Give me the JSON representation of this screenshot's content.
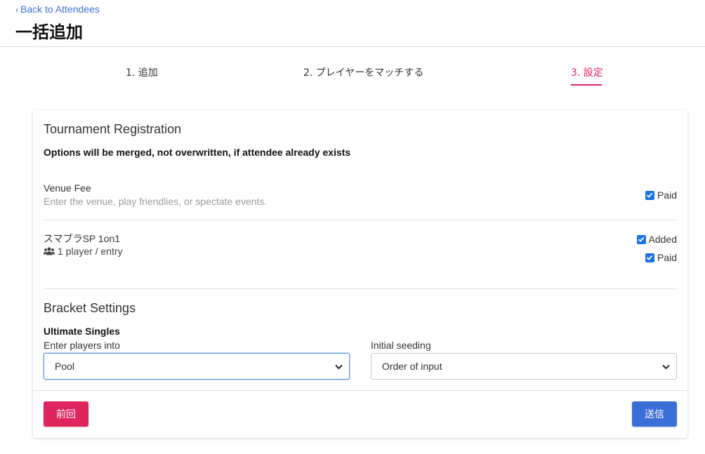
{
  "header": {
    "back_label": "Back to Attendees",
    "title": "一括追加"
  },
  "stepper": {
    "steps": [
      {
        "label": "1. 追加",
        "active": false
      },
      {
        "label": "2. プレイヤーをマッチする",
        "active": false
      },
      {
        "label": "3. 設定",
        "active": true
      }
    ],
    "active_color": "#e0245e"
  },
  "registration": {
    "title": "Tournament Registration",
    "note": "Options will be merged, not overwritten, if attendee already exists",
    "venue_fee": {
      "name": "Venue Fee",
      "description": "Enter the venue, play friendlies, or spectate events.",
      "paid_label": "Paid",
      "paid_checked": true
    },
    "event": {
      "name": "スマブラSP 1on1",
      "players_text": "1 player / entry",
      "players_icon": "users-icon",
      "added_label": "Added",
      "added_checked": true,
      "paid_label": "Paid",
      "paid_checked": true
    }
  },
  "bracket": {
    "title": "Bracket Settings",
    "bracket_name": "Ultimate Singles",
    "enter_into_label": "Enter players into",
    "enter_into_value": "Pool",
    "seeding_label": "Initial seeding",
    "seeding_value": "Order of input"
  },
  "footer": {
    "prev_label": "前回",
    "submit_label": "送信"
  },
  "colors": {
    "accent_pink": "#e0245e",
    "accent_blue": "#3b6fd8",
    "checkbox_blue": "#1a73e8"
  }
}
